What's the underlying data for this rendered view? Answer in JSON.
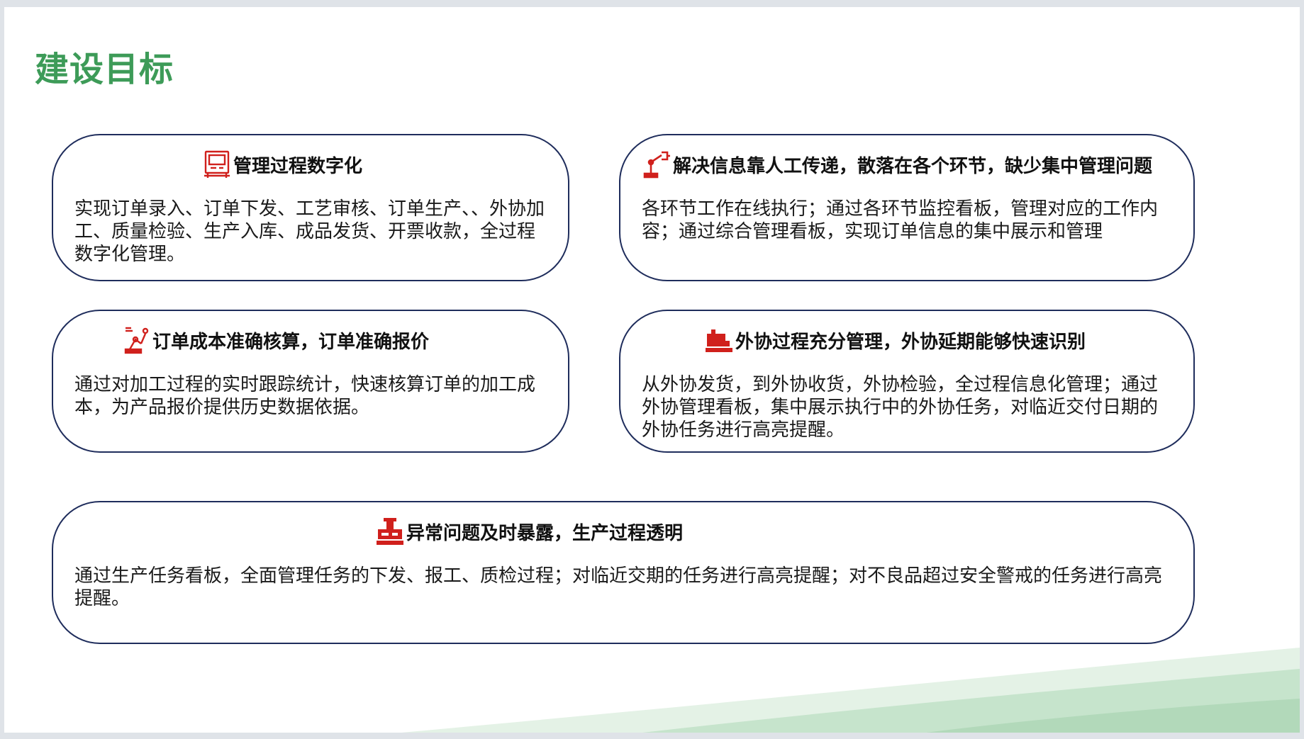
{
  "title": "建设目标",
  "colors": {
    "title_green": "#3d9b58",
    "card_border": "#1f2d5c",
    "icon_red": "#d0201c",
    "wave_green": "#bfe0c6"
  },
  "cards": [
    {
      "icon": "control-panel-icon",
      "title": "管理过程数字化",
      "body": "实现订单录入、订单下发、工艺审核、订单生产、、外协加工、质量检验、生产入库、成品发货、开票收款，全过程数字化管理。"
    },
    {
      "icon": "robot-arm-icon",
      "title": "解决信息靠人工传递，散落在各个环节，缺少集中管理问题",
      "body": "各环节工作在线执行；通过各环节监控看板，管理对应的工作内容；通过综合管理看板，实现订单信息的集中展示和管理"
    },
    {
      "icon": "industrial-robot-icon",
      "title": "订单成本准确核算，订单准确报价",
      "body": "通过对加工过程的实时跟踪统计，快速核算订单的加工成本，为产品报价提供历史数据依据。"
    },
    {
      "icon": "sewing-machine-icon",
      "title": "外协过程充分管理，外协延期能够快速识别",
      "body": "从外协发货，到外协收货，外协检验，全过程信息化管理；通过外协管理看板，集中展示执行中的外协任务，对临近交付日期的外协任务进行高亮提醒。"
    },
    {
      "icon": "machine-tool-icon",
      "title": "异常问题及时暴露，生产过程透明",
      "body": "通过生产任务看板，全面管理任务的下发、报工、质检过程；对临近交期的任务进行高亮提醒；对不良品超过安全警戒的任务进行高亮提醒。"
    }
  ]
}
